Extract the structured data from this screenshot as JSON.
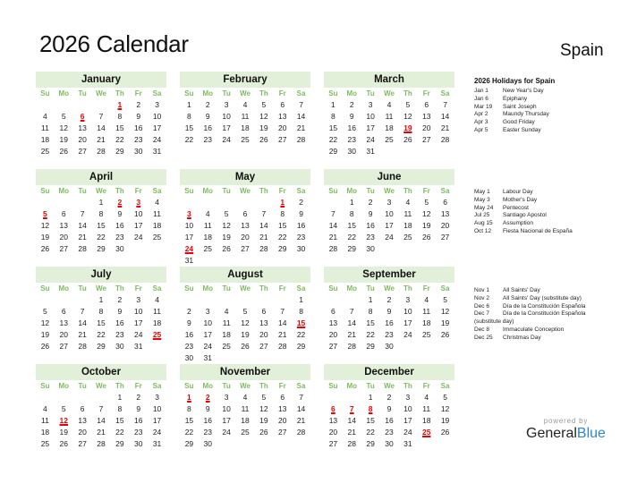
{
  "title": "2026 Calendar",
  "country": "Spain",
  "weekdays": [
    "Su",
    "Mo",
    "Tu",
    "We",
    "Th",
    "Fr",
    "Sa"
  ],
  "colors": {
    "header_bg": "#e2efd9",
    "weekday": "#7cbb5e",
    "holiday": "#e00000",
    "brand_blue": "#2d87c8"
  },
  "months": [
    {
      "name": "January",
      "start": 4,
      "days": 31,
      "holidays": [
        1,
        6
      ]
    },
    {
      "name": "February",
      "start": 0,
      "days": 28,
      "holidays": []
    },
    {
      "name": "March",
      "start": 0,
      "days": 31,
      "holidays": [
        19
      ]
    },
    {
      "name": "April",
      "start": 3,
      "days": 30,
      "holidays": [
        2,
        3,
        5
      ]
    },
    {
      "name": "May",
      "start": 5,
      "days": 31,
      "holidays": [
        1,
        3,
        24
      ]
    },
    {
      "name": "June",
      "start": 1,
      "days": 30,
      "holidays": []
    },
    {
      "name": "July",
      "start": 3,
      "days": 31,
      "holidays": [
        25
      ]
    },
    {
      "name": "August",
      "start": 6,
      "days": 31,
      "holidays": [
        15
      ]
    },
    {
      "name": "September",
      "start": 2,
      "days": 30,
      "holidays": []
    },
    {
      "name": "October",
      "start": 4,
      "days": 31,
      "holidays": [
        12
      ]
    },
    {
      "name": "November",
      "start": 0,
      "days": 30,
      "holidays": [
        1,
        2
      ]
    },
    {
      "name": "December",
      "start": 2,
      "days": 31,
      "holidays": [
        6,
        7,
        8,
        25
      ]
    }
  ],
  "holiday_title": "2026 Holidays for Spain",
  "holiday_groups": [
    [
      {
        "date": "Jan 1",
        "name": "New Year's Day"
      },
      {
        "date": "Jan 6",
        "name": "Epiphany"
      },
      {
        "date": "Mar 19",
        "name": "Saint Joseph"
      },
      {
        "date": "Apr 2",
        "name": "Maundy Thursday"
      },
      {
        "date": "Apr 3",
        "name": "Good Friday"
      },
      {
        "date": "Apr 5",
        "name": "Easter Sunday"
      }
    ],
    [
      {
        "date": "May 1",
        "name": "Labour Day"
      },
      {
        "date": "May 3",
        "name": "Mother's Day"
      },
      {
        "date": "May 24",
        "name": "Pentecost"
      },
      {
        "date": "Jul 25",
        "name": "Santiago Apostol"
      },
      {
        "date": "Aug 15",
        "name": "Assumption"
      },
      {
        "date": "Oct 12",
        "name": "Fiesta Nacional de España"
      }
    ],
    [
      {
        "date": "Nov 1",
        "name": "All Saints' Day"
      },
      {
        "date": "Nov 2",
        "name": "All Saints' Day (substitute day)"
      },
      {
        "date": "Dec 6",
        "name": "Día de la Constitución Española"
      },
      {
        "date": "Dec 7",
        "name": "Día de la Constitución Española"
      },
      {
        "date": "",
        "name": "(substitute day)"
      },
      {
        "date": "Dec 8",
        "name": "Immaculate Conception"
      },
      {
        "date": "Dec 25",
        "name": "Christmas Day"
      }
    ]
  ],
  "footer": {
    "powered": "powered by",
    "brand_general": "General",
    "brand_blue": "Blue"
  }
}
